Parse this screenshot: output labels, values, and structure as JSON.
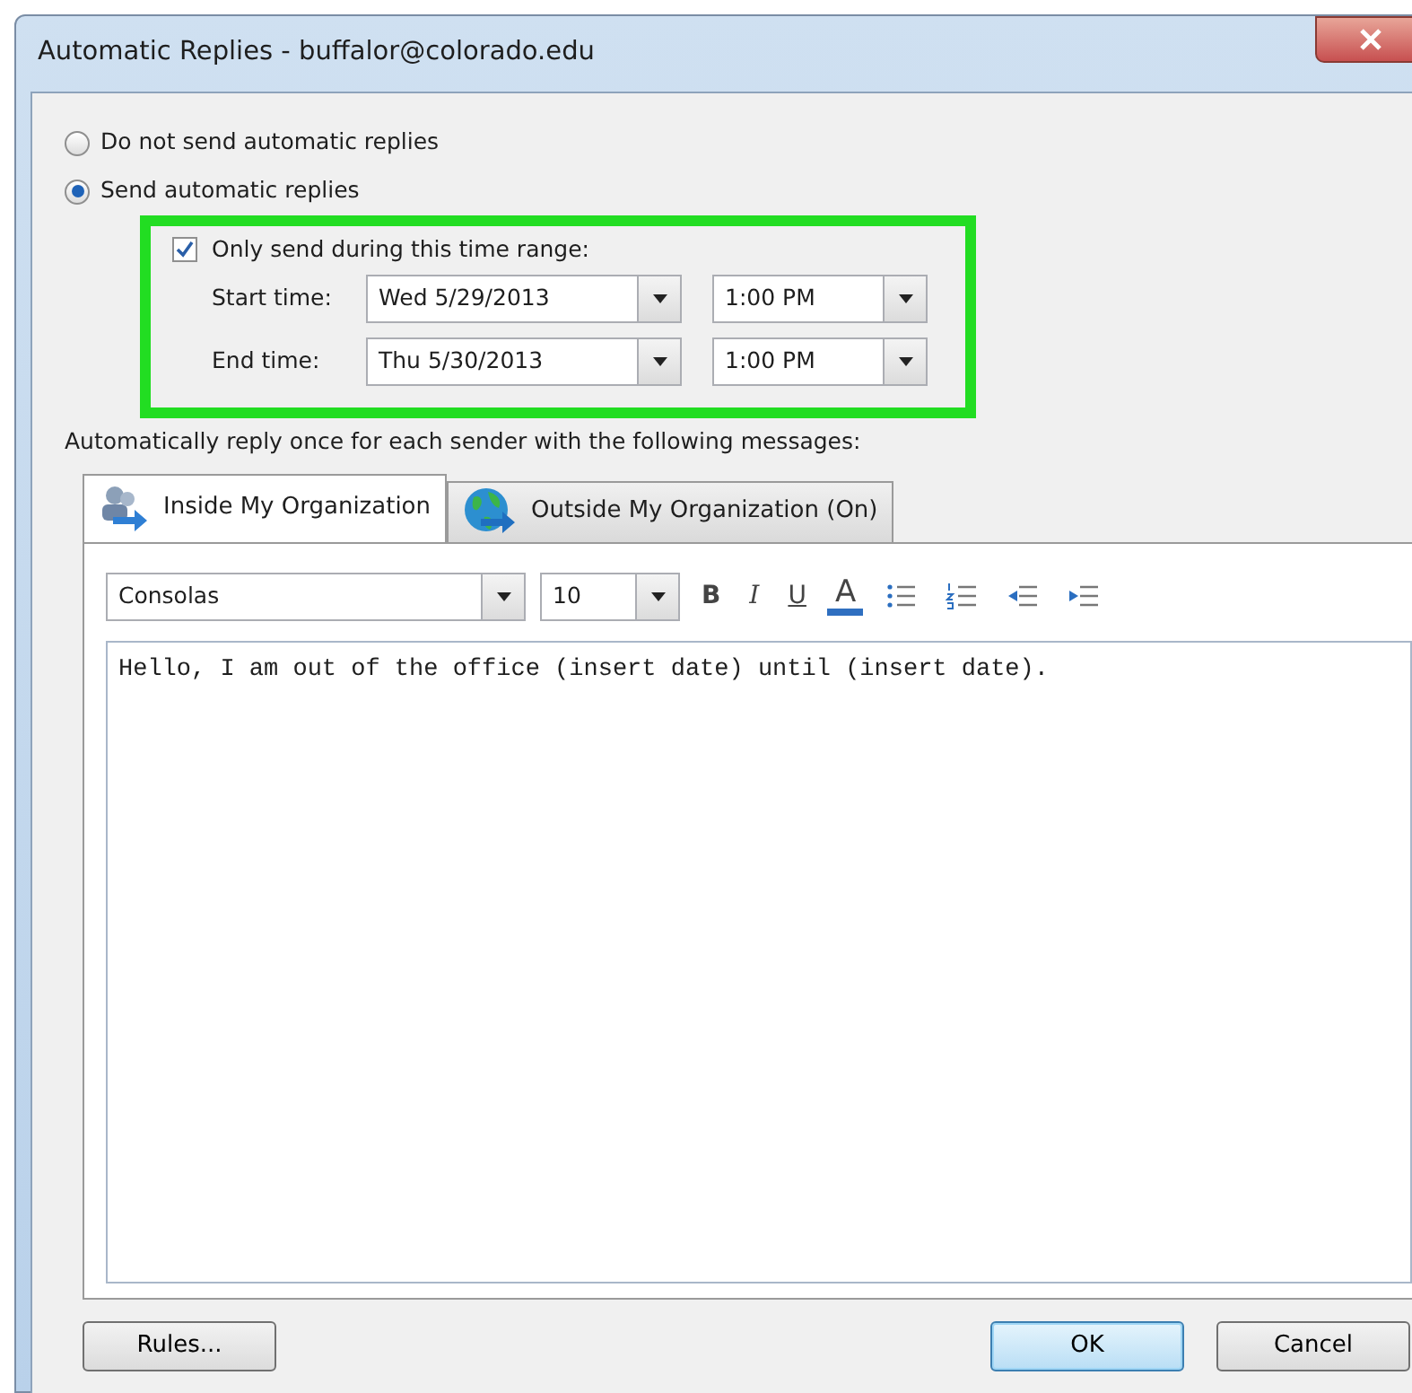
{
  "window": {
    "title": "Automatic Replies - buffalor@colorado.edu"
  },
  "reply_mode": [
    {
      "label": "Do not send automatic replies",
      "selected": false
    },
    {
      "label": "Send automatic replies",
      "selected": true
    }
  ],
  "time_range": {
    "label": "Only send during this time range:",
    "checked": true,
    "highlighted": true,
    "rows": [
      {
        "label": "Start time:",
        "date": "Wed 5/29/2013",
        "time": "1:00 PM"
      },
      {
        "label": "End time:",
        "date": "Thu 5/30/2013",
        "time": "1:00 PM"
      }
    ]
  },
  "message_intro": "Automatically reply once for each sender with the following messages:",
  "tabs": [
    {
      "label": "Inside My Organization",
      "selected": true,
      "kind": "people"
    },
    {
      "label": "Outside My Organization (On)",
      "selected": false,
      "kind": "globe"
    }
  ],
  "toolbar": {
    "font": "Consolas",
    "size": "10",
    "buttons": [
      {
        "kind": "bold",
        "label": "B"
      },
      {
        "kind": "italic",
        "label": "I"
      },
      {
        "kind": "underline",
        "label": "U"
      },
      {
        "kind": "color",
        "label": "A"
      },
      {
        "kind": "bullets"
      },
      {
        "kind": "numbering"
      },
      {
        "kind": "outdent"
      },
      {
        "kind": "indent"
      }
    ]
  },
  "message": "Hello, I am out of the office (insert date) until (insert date).",
  "buttons": [
    {
      "label": "Rules...",
      "default": false
    },
    {
      "label": "OK",
      "default": true
    },
    {
      "label": "Cancel",
      "default": false
    }
  ]
}
